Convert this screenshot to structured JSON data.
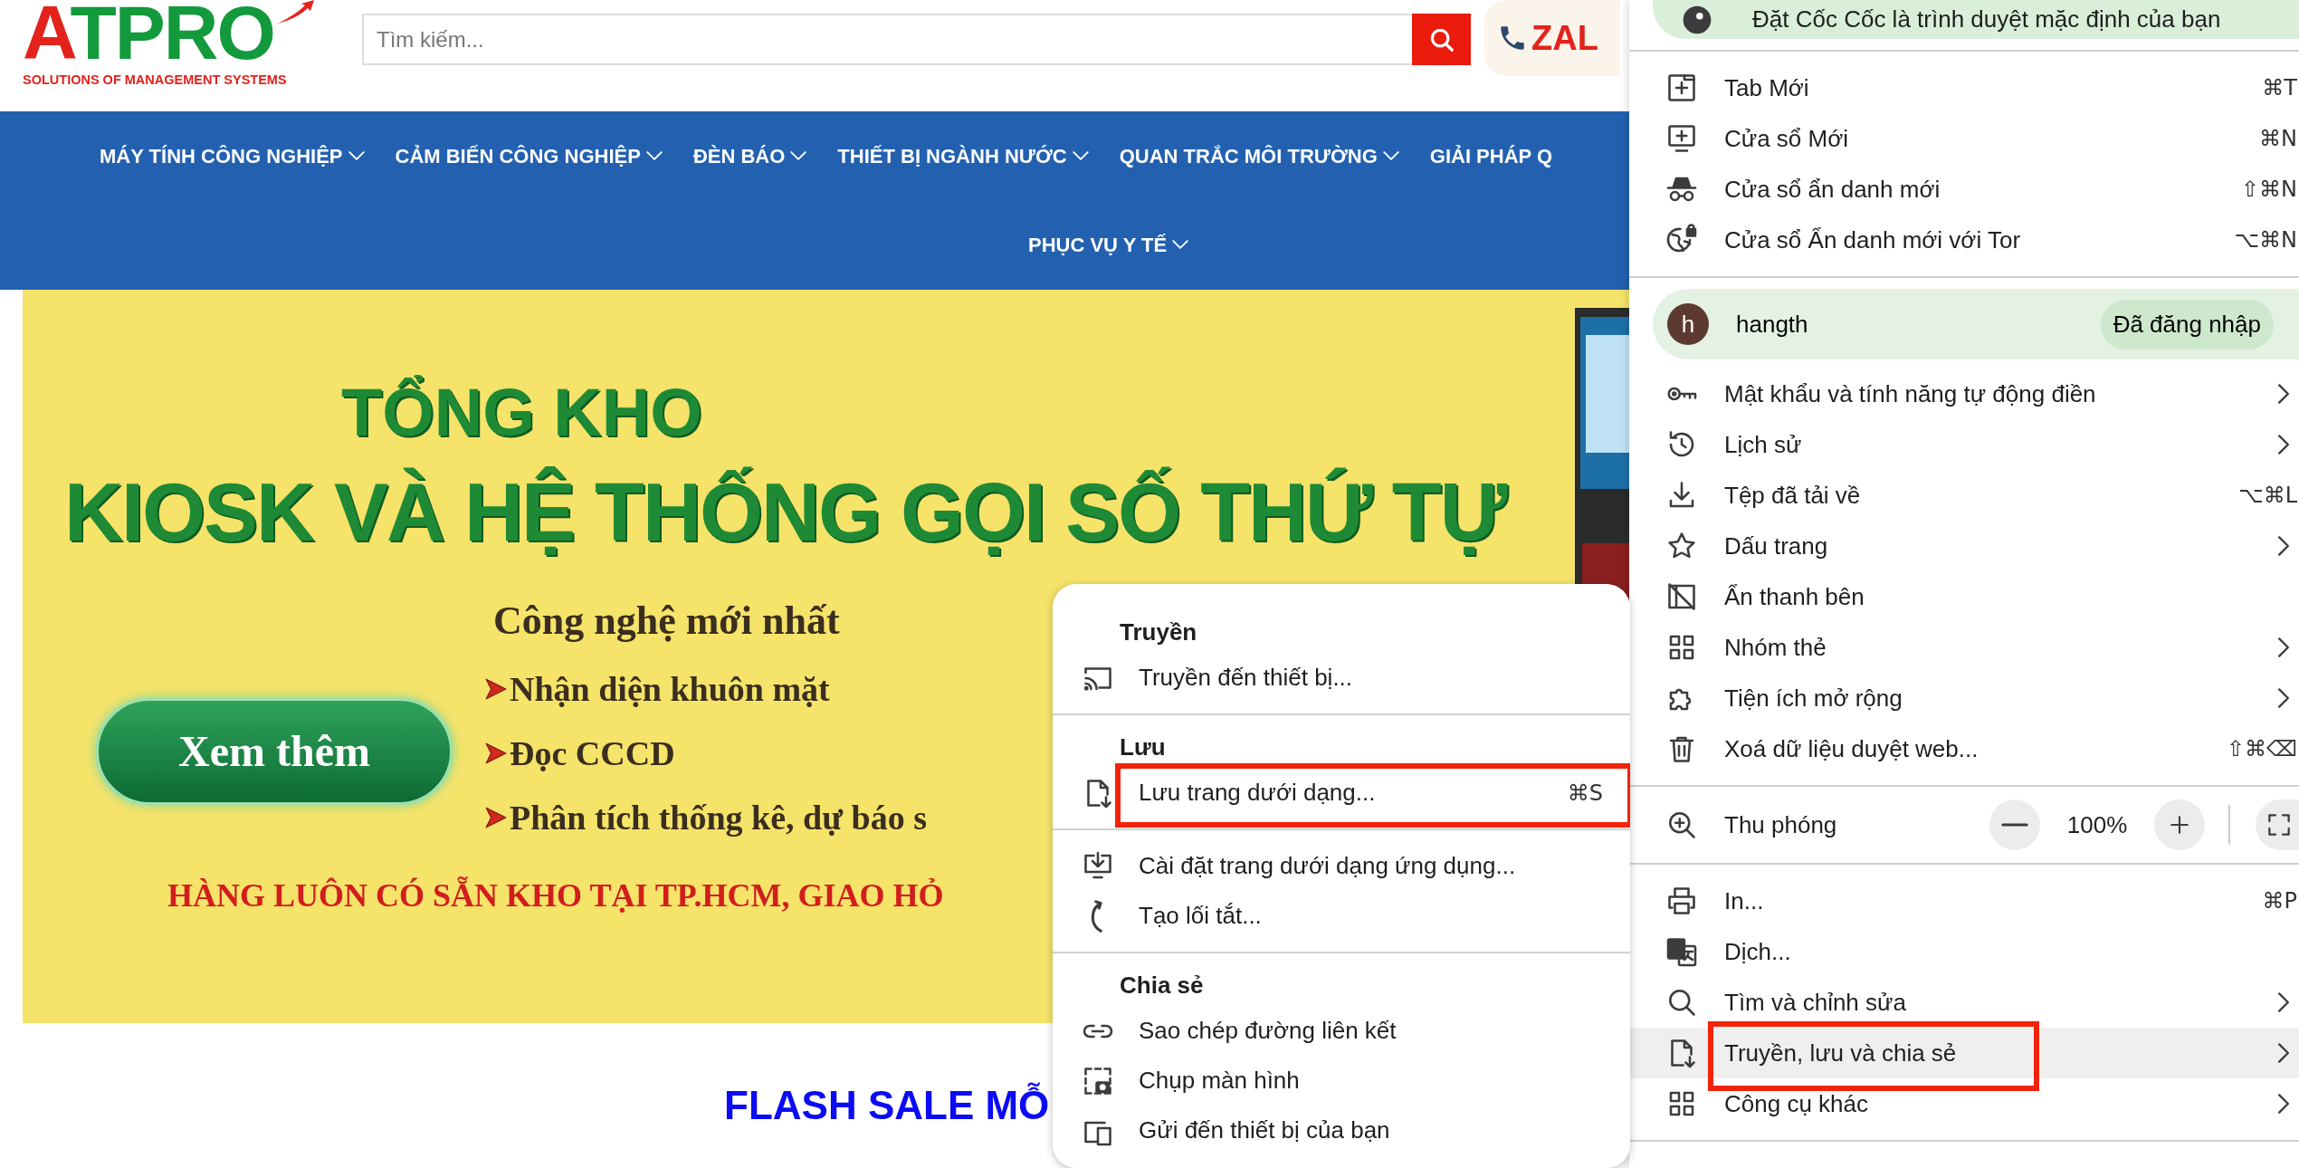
{
  "page": {
    "logo": {
      "wordmark": "ATPRO",
      "tagline": "SOLUTIONS OF MANAGEMENT SYSTEMS"
    },
    "search": {
      "placeholder": "Tìm kiếm..."
    },
    "hotline": {
      "label": "ZAL"
    },
    "nav_rows": [
      [
        {
          "label": "MÁY TÍNH CÔNG NGHIỆP",
          "has_dropdown": true
        },
        {
          "label": "CẢM BIẾN CÔNG NGHIỆP",
          "has_dropdown": true
        },
        {
          "label": "ĐÈN BÁO",
          "has_dropdown": true
        },
        {
          "label": "THIẾT BỊ NGÀNH NƯỚC",
          "has_dropdown": true
        },
        {
          "label": "QUAN TRẮC MÔI TRƯỜNG",
          "has_dropdown": true
        },
        {
          "label": "GIẢI PHÁP Q",
          "has_dropdown": false
        }
      ],
      [
        {
          "label": "PHỤC VỤ Y TẾ",
          "has_dropdown": true
        }
      ]
    ],
    "banner": {
      "title": "TỔNG KHO",
      "headline": "KIOSK VÀ HỆ THỐNG GỌI SỐ THỨ TỰ",
      "subtitle": "Công nghệ mới nhất",
      "button": "Xem thêm",
      "features": [
        "Nhận diện khuôn mặt",
        "Đọc CCCD",
        "Phân tích thống kê, dự báo s"
      ],
      "footer": "HÀNG LUÔN CÓ SẴN KHO TẠI TP.HCM, GIAO HỎ"
    },
    "flash_sale": {
      "heading": "FLASH SALE MỖ"
    }
  },
  "browser_menu": {
    "banner": "Đặt Cốc Cốc là trình duyệt mặc định của bạn",
    "blocks": [
      {
        "kind": "items",
        "items": [
          {
            "label": "Tab Mới",
            "shortcut": "⌘T",
            "has_submenu": false,
            "selected": false,
            "annotated": false
          },
          {
            "label": "Cửa sổ Mới",
            "shortcut": "⌘N",
            "has_submenu": false,
            "selected": false,
            "annotated": false
          },
          {
            "label": "Cửa sổ ẩn danh mới",
            "shortcut": "⇧⌘N",
            "has_submenu": false,
            "selected": false,
            "annotated": false
          },
          {
            "label": "Cửa sổ Ẩn danh mới với Tor",
            "shortcut": "⌥⌘N",
            "has_submenu": false,
            "selected": false,
            "annotated": false
          }
        ]
      },
      {
        "kind": "profile",
        "initial": "h",
        "name": "hangth",
        "status": "Đã đăng nhập"
      },
      {
        "kind": "items",
        "items": [
          {
            "label": "Mật khẩu và tính năng tự động điền",
            "has_submenu": true,
            "selected": false,
            "annotated": false
          },
          {
            "label": "Lịch sử",
            "has_submenu": true,
            "selected": false,
            "annotated": false
          },
          {
            "label": "Tệp đã tải về",
            "shortcut": "⌥⌘L",
            "has_submenu": false,
            "selected": false,
            "annotated": false
          },
          {
            "label": "Dấu trang",
            "has_submenu": true,
            "selected": false,
            "annotated": false
          },
          {
            "label": "Ẩn thanh bên",
            "has_submenu": false,
            "selected": false,
            "annotated": false
          },
          {
            "label": "Nhóm thẻ",
            "has_submenu": true,
            "selected": false,
            "annotated": false
          },
          {
            "label": "Tiện ích mở rộng",
            "has_submenu": true,
            "selected": false,
            "annotated": false
          },
          {
            "label": "Xoá dữ liệu duyệt web...",
            "shortcut": "⇧⌘⌫",
            "has_submenu": false,
            "selected": false,
            "annotated": false
          }
        ]
      },
      {
        "kind": "zoom",
        "label": "Thu phóng",
        "value": "100%"
      },
      {
        "kind": "items",
        "items": [
          {
            "label": "In...",
            "shortcut": "⌘P",
            "has_submenu": false,
            "selected": false,
            "annotated": false
          },
          {
            "label": "Dịch...",
            "has_submenu": false,
            "selected": false,
            "annotated": false
          },
          {
            "label": "Tìm và chỉnh sửa",
            "has_submenu": true,
            "selected": false,
            "annotated": false
          },
          {
            "label": "Truyền, lưu và chia sẻ",
            "has_submenu": true,
            "selected": true,
            "annotated": true
          },
          {
            "label": "Công cụ khác",
            "has_submenu": true,
            "selected": false,
            "annotated": false
          }
        ]
      }
    ]
  },
  "submenu": {
    "groups": [
      {
        "heading": "Truyền",
        "items": [
          {
            "label": "Truyền đến thiết bị...",
            "selected": false,
            "annotated": false
          }
        ]
      },
      {
        "heading": "Lưu",
        "items": [
          {
            "label": "Lưu trang dưới dạng...",
            "shortcut": "⌘S",
            "selected": false,
            "annotated": true
          }
        ]
      },
      {
        "items": [
          {
            "label": "Cài đặt trang dưới dạng ứng dụng...",
            "selected": false,
            "annotated": false
          },
          {
            "label": "Tạo lối tắt...",
            "selected": false,
            "annotated": false
          }
        ]
      },
      {
        "heading": "Chia sẻ",
        "items": [
          {
            "label": "Sao chép đường liên kết",
            "selected": false,
            "annotated": false
          },
          {
            "label": "Chụp màn hình",
            "selected": false,
            "annotated": false
          },
          {
            "label": "Gửi đến thiết bị của bạn",
            "selected": false,
            "annotated": false
          }
        ]
      }
    ]
  }
}
